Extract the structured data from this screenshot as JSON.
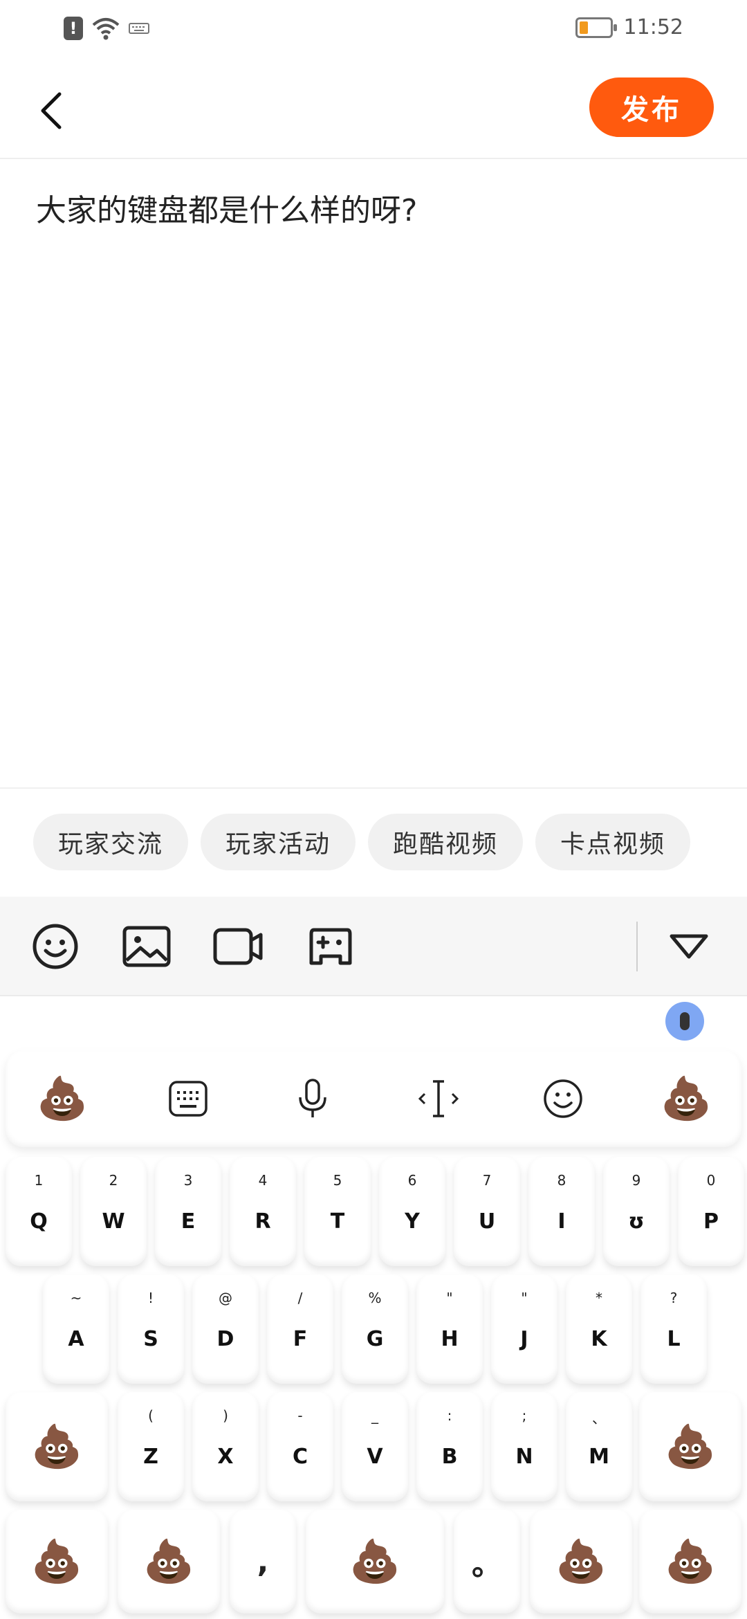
{
  "status_bar": {
    "alert_glyph": "!",
    "time": "11:52",
    "battery_level": 0.25,
    "battery_color": "#f19a1e"
  },
  "header": {
    "back_icon": "chevron-left-icon",
    "publish_label": "发布",
    "publish_color": "#ff5a0e"
  },
  "compose": {
    "text": "大家的键盘都是什么样的呀?"
  },
  "topics": [
    "玩家交流",
    "玩家活动",
    "跑酷视频",
    "卡点视频"
  ],
  "toolbar": {
    "icons": [
      "emoji-icon",
      "image-icon",
      "video-icon",
      "gamepad-icon",
      "collapse-triangle-icon"
    ]
  },
  "keyboard": {
    "emoji_glyph": "💩",
    "toolbar_icons": [
      "poop-emoji-icon",
      "keyboard-icon",
      "microphone-icon",
      "cursor-icon",
      "smiley-icon",
      "poop-emoji-icon"
    ],
    "row1": [
      {
        "hint": "1",
        "label": "Q"
      },
      {
        "hint": "2",
        "label": "W"
      },
      {
        "hint": "3",
        "label": "E"
      },
      {
        "hint": "4",
        "label": "R"
      },
      {
        "hint": "5",
        "label": "T"
      },
      {
        "hint": "6",
        "label": "Y"
      },
      {
        "hint": "7",
        "label": "U"
      },
      {
        "hint": "8",
        "label": "I"
      },
      {
        "hint": "9",
        "label": "ʊ"
      },
      {
        "hint": "0",
        "label": "P"
      }
    ],
    "row2": [
      {
        "hint": "~",
        "label": "A"
      },
      {
        "hint": "!",
        "label": "S"
      },
      {
        "hint": "@",
        "label": "D"
      },
      {
        "hint": "/",
        "label": "F"
      },
      {
        "hint": "%",
        "label": "G"
      },
      {
        "hint": "\"",
        "label": "H"
      },
      {
        "hint": "\"",
        "label": "J"
      },
      {
        "hint": "*",
        "label": "K"
      },
      {
        "hint": "?",
        "label": "L"
      }
    ],
    "row3": [
      {
        "hint": "(",
        "label": "Z"
      },
      {
        "hint": ")",
        "label": "X"
      },
      {
        "hint": "-",
        "label": "C"
      },
      {
        "hint": "_",
        "label": "V"
      },
      {
        "hint": ":",
        "label": "B"
      },
      {
        "hint": ";",
        "label": "N"
      },
      {
        "hint": "、",
        "label": "M"
      }
    ],
    "row4_comma": ",",
    "row4_period": "。"
  }
}
